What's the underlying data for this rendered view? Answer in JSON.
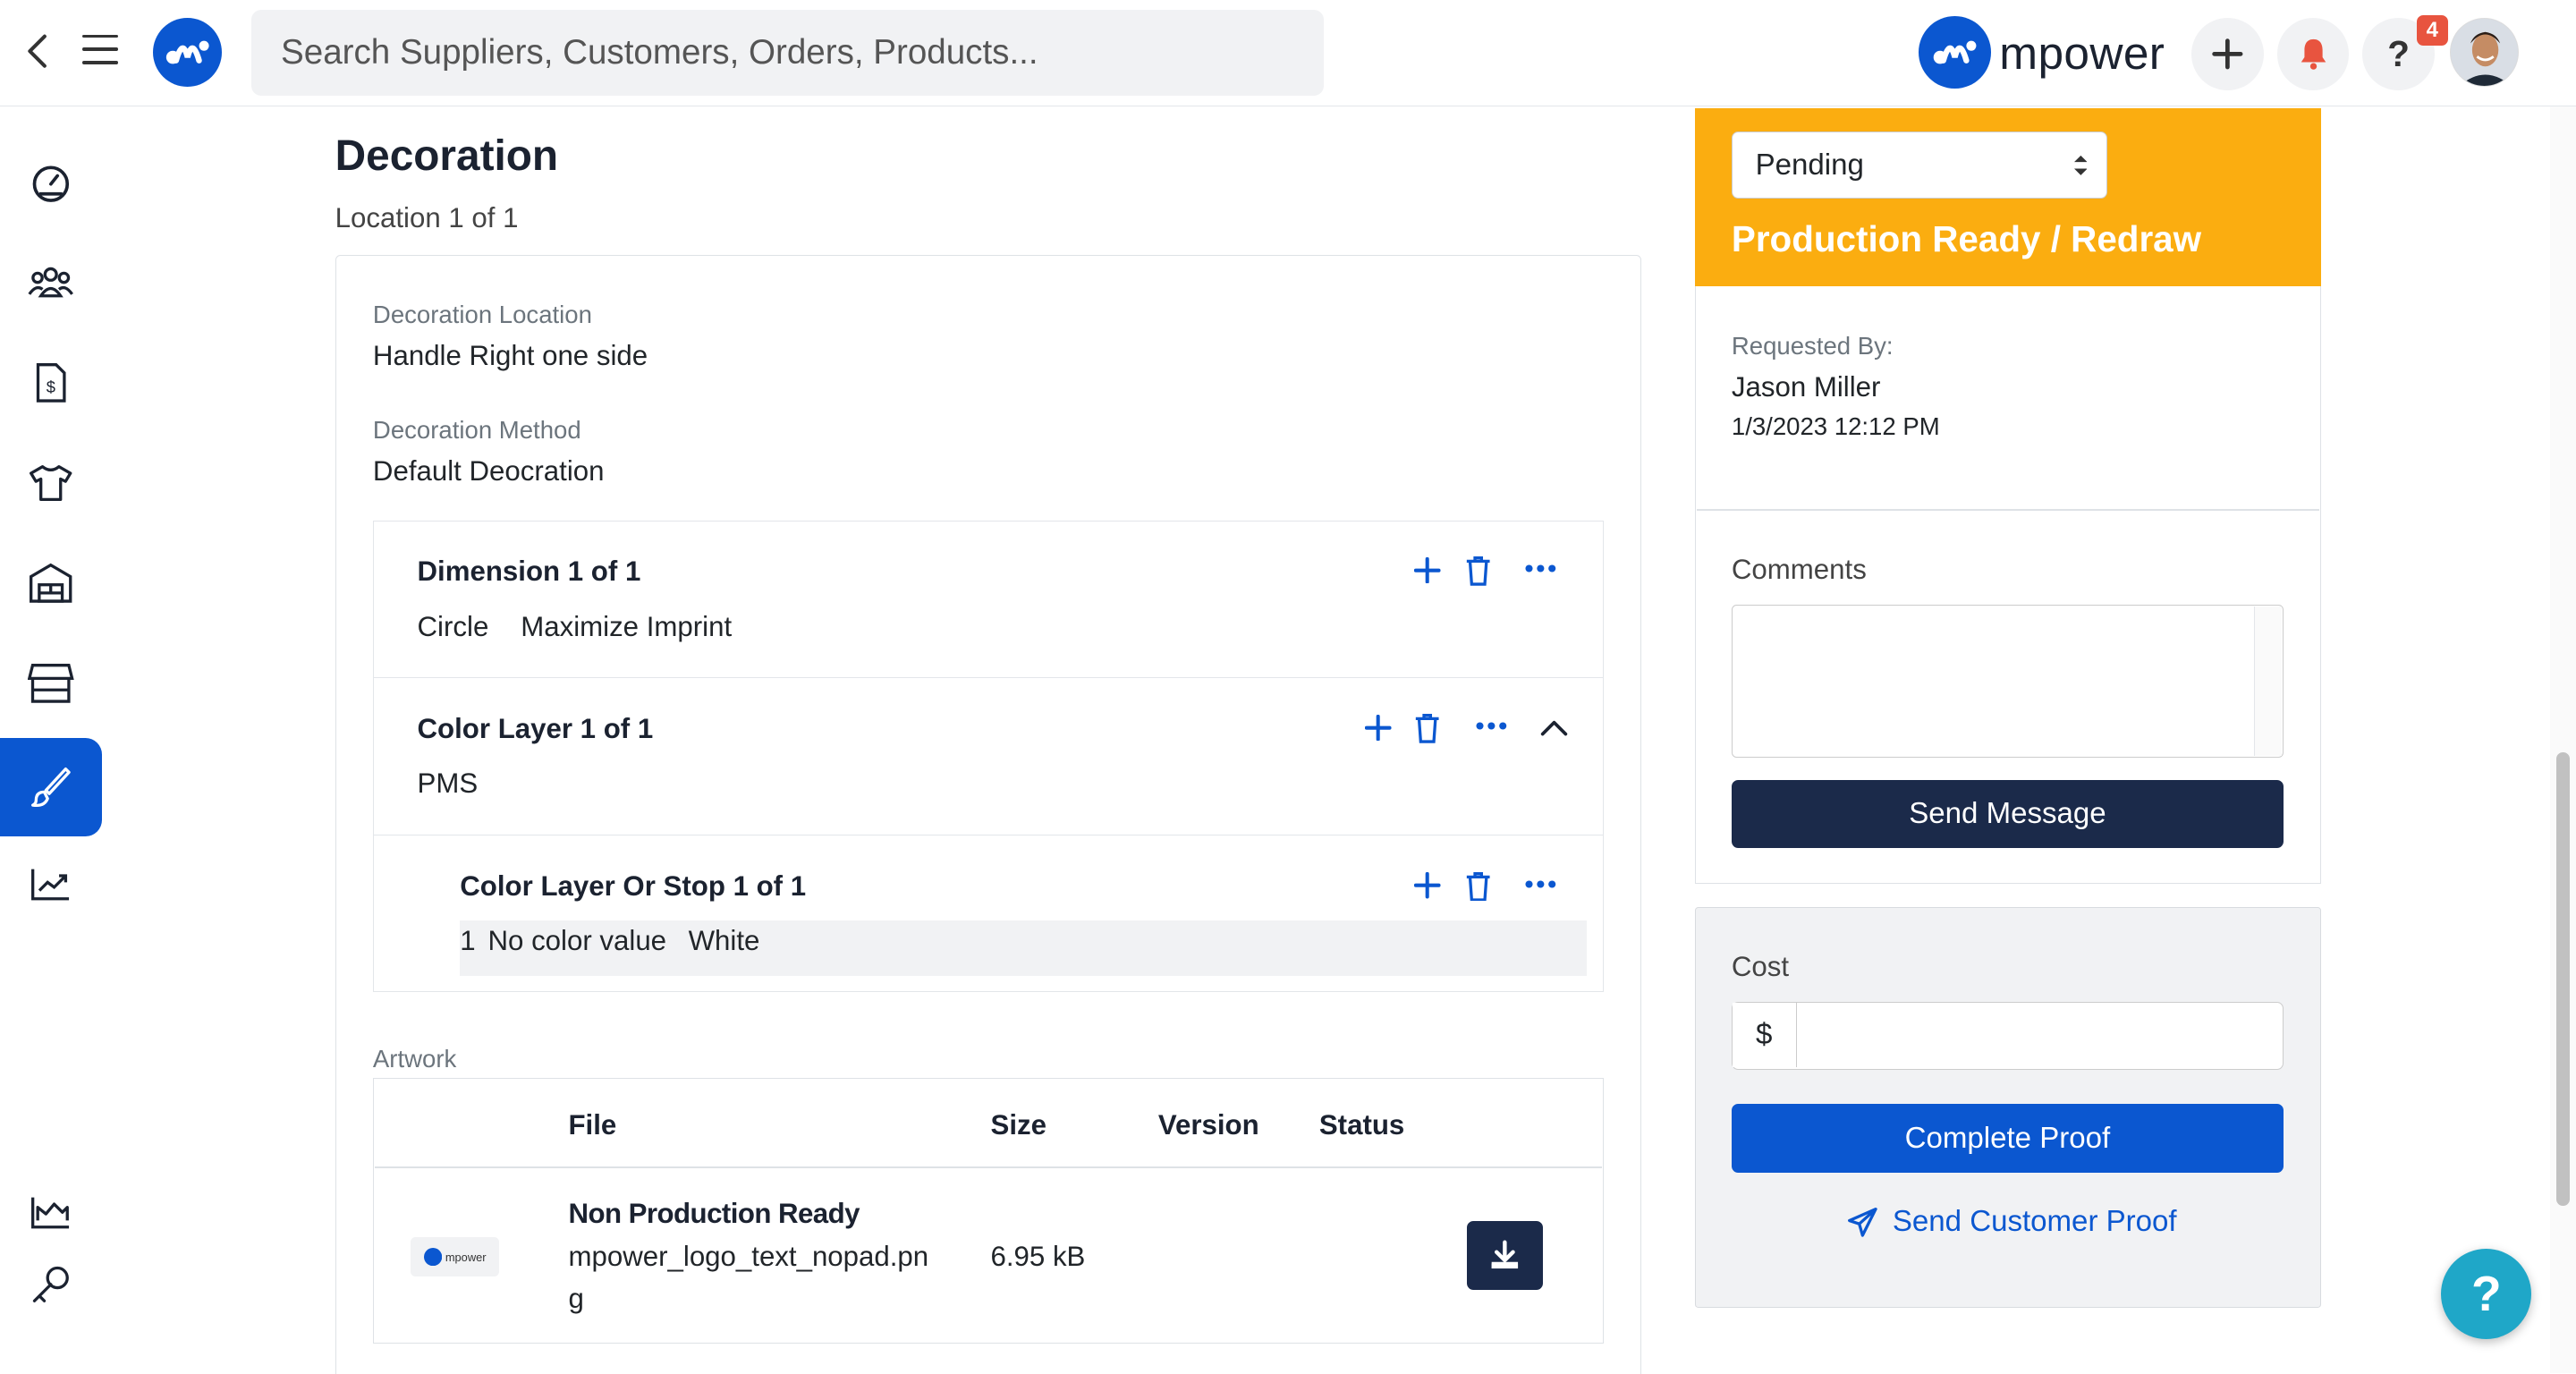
{
  "topbar": {
    "search_placeholder": "Search Suppliers, Customers, Orders, Products...",
    "brand_name": "mpower",
    "notification_count": "4",
    "help_label": "?"
  },
  "sidebar": {
    "items": [
      {
        "icon": "dashboard-icon"
      },
      {
        "icon": "users-icon"
      },
      {
        "icon": "invoice-icon"
      },
      {
        "icon": "tshirt-icon"
      },
      {
        "icon": "warehouse-icon"
      },
      {
        "icon": "store-icon"
      },
      {
        "icon": "brush-icon",
        "active": true
      },
      {
        "icon": "trending-chart-icon"
      },
      {
        "icon": "area-chart-icon"
      },
      {
        "icon": "key-icon"
      }
    ]
  },
  "decoration": {
    "title": "Decoration",
    "location_sub": "Location 1 of 1",
    "location_label": "Decoration Location",
    "location_value": "Handle Right one side",
    "method_label": "Decoration Method",
    "method_value": "Default Deocration",
    "dimension": {
      "title": "Dimension 1 of 1",
      "shape": "Circle",
      "imprint": "Maximize Imprint"
    },
    "color_layer": {
      "title": "Color Layer 1 of 1",
      "value": "PMS"
    },
    "color_stop": {
      "title": "Color Layer Or Stop 1 of 1",
      "index": "1",
      "color_value": "No color value",
      "color_name": "White"
    }
  },
  "artwork": {
    "label": "Artwork",
    "columns": [
      "File",
      "Size",
      "Version",
      "Status"
    ],
    "rows": [
      {
        "thumb_text": "mpower",
        "name": "Non Production Ready",
        "filename_line1": "mpower_logo_text_nopad.pn",
        "filename_line2": "g",
        "size": "6.95 kB",
        "version": "",
        "status": ""
      }
    ]
  },
  "status_panel": {
    "select_value": "Pending",
    "status_label": "Production Ready / Redraw",
    "status_color": "#fbad10",
    "requested_by_label": "Requested By:",
    "requested_by_name": "Jason Miller",
    "requested_date": "1/3/2023 12:12 PM",
    "comments_label": "Comments",
    "comments_value": "",
    "send_message_label": "Send Message"
  },
  "cost_panel": {
    "cost_label": "Cost",
    "currency_prefix": "$",
    "cost_value": "",
    "complete_proof_label": "Complete Proof",
    "send_customer_proof_label": "Send Customer Proof"
  },
  "colors": {
    "primary": "#0b57d0",
    "navy": "#1b2a4a",
    "status_orange": "#fbad10",
    "help_fab": "#1fa7c8"
  }
}
